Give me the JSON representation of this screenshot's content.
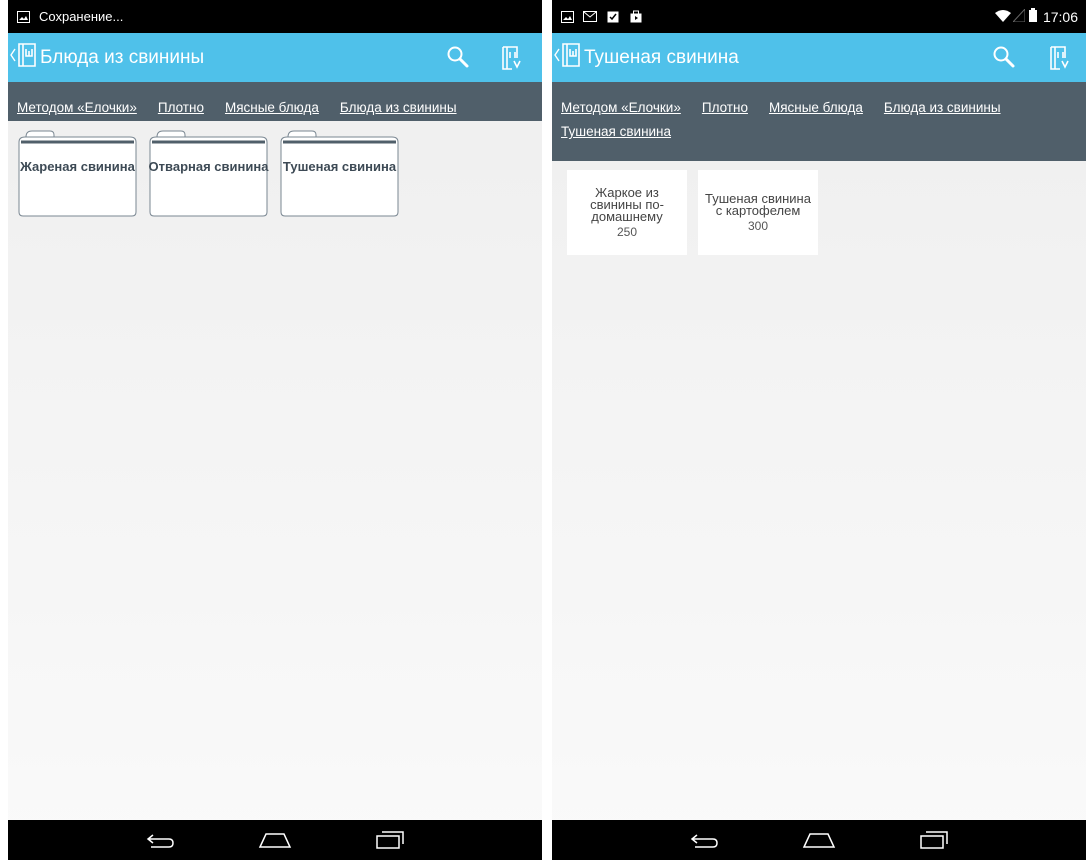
{
  "left": {
    "status": {
      "notification_text": "Сохранение..."
    },
    "actionbar": {
      "title": "Блюда из свинины"
    },
    "breadcrumbs": [
      "Методом «Елочки»",
      "Плотно",
      "Мясные блюда",
      "Блюда из свинины"
    ],
    "folders": [
      {
        "label": "Жареная свинина"
      },
      {
        "label": "Отварная свинина"
      },
      {
        "label": "Тушеная свинина"
      }
    ]
  },
  "right": {
    "status": {
      "clock": "17:06"
    },
    "actionbar": {
      "title": "Тушеная свинина"
    },
    "breadcrumbs": [
      "Методом «Елочки»",
      "Плотно",
      "Мясные блюда",
      "Блюда из свинины",
      "Тушеная свинина"
    ],
    "dishes": [
      {
        "name": "Жаркое из свинины по-домашнему",
        "value": "250"
      },
      {
        "name": "Тушеная свинина с картофелем",
        "value": "300"
      }
    ]
  },
  "colors": {
    "actionbar": "#4fc1ea",
    "breadcrumb_bar": "#505f6a",
    "folder_text": "#3d4a55"
  },
  "icons": [
    "image-icon",
    "gmail-icon",
    "clipboard-icon",
    "store-icon",
    "wifi-icon",
    "signal-icon",
    "battery-icon",
    "up-caret-icon",
    "app-logo-icon",
    "search-icon",
    "bookmark-icon",
    "back-icon",
    "home-icon",
    "recents-icon"
  ]
}
